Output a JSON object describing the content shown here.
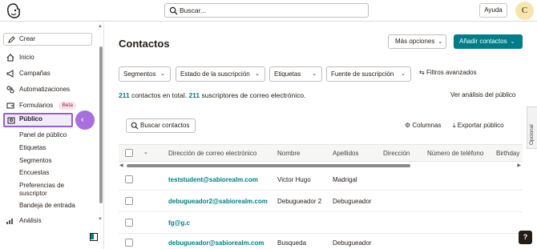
{
  "topbar": {
    "search_placeholder": "Buscar...",
    "help_label": "Ayuda",
    "avatar_initial": "C"
  },
  "sidebar": {
    "create_label": "Crear",
    "items": [
      {
        "label": "Inicio",
        "icon": "home-icon"
      },
      {
        "label": "Campañas",
        "icon": "megaphone-icon"
      },
      {
        "label": "Automatizaciones",
        "icon": "automation-icon"
      },
      {
        "label": "Formularios",
        "icon": "form-icon",
        "badge": "Beta"
      },
      {
        "label": "Público",
        "icon": "audience-icon",
        "active": true
      },
      {
        "label": "Análisis",
        "icon": "chart-icon"
      }
    ],
    "subitems": [
      "Panel de público",
      "Etiquetas",
      "Segmentos",
      "Encuestas",
      "Preferencias de suscriptor",
      "Bandeja de entrada"
    ]
  },
  "main": {
    "title": "Contactos",
    "more_options": "Más opciones",
    "add_contacts": "Añadir contactos",
    "filters": [
      "Segmentos",
      "Estado de la suscripción",
      "Etiquetas",
      "Fuente de suscripción"
    ],
    "advanced_filters": "Filtros avanzados",
    "summary": {
      "total": "211",
      "text1": " contactos en total. ",
      "subscribers": "211",
      "text2": " suscriptores de correo electrónico."
    },
    "view_analysis": "Ver análisis del público",
    "search_contacts": "Buscar contactos",
    "columns": "Columnas",
    "export": "Exportar público",
    "optional_tab": "Opcional"
  },
  "table": {
    "columns": [
      "Dirección de correo electrónico",
      "Nombre",
      "Apellidos",
      "Dirección",
      "Número de teléfono",
      "Birthday"
    ],
    "rows": [
      {
        "email": "teststudent@sabiorealm.com",
        "first": "Victor Hugo",
        "last": "Madrigal"
      },
      {
        "email": "debugueador2@sabiorealm.com",
        "first": "Debugueador 2",
        "last": "Debugueador"
      },
      {
        "email": "fg@g.c",
        "first": "",
        "last": ""
      },
      {
        "email": "debugueador@sabiorealm.com",
        "first": "Busqueda",
        "last": "Debugueador"
      }
    ]
  },
  "colors": {
    "accent": "#007c89",
    "highlight": "#9b5cd6"
  }
}
